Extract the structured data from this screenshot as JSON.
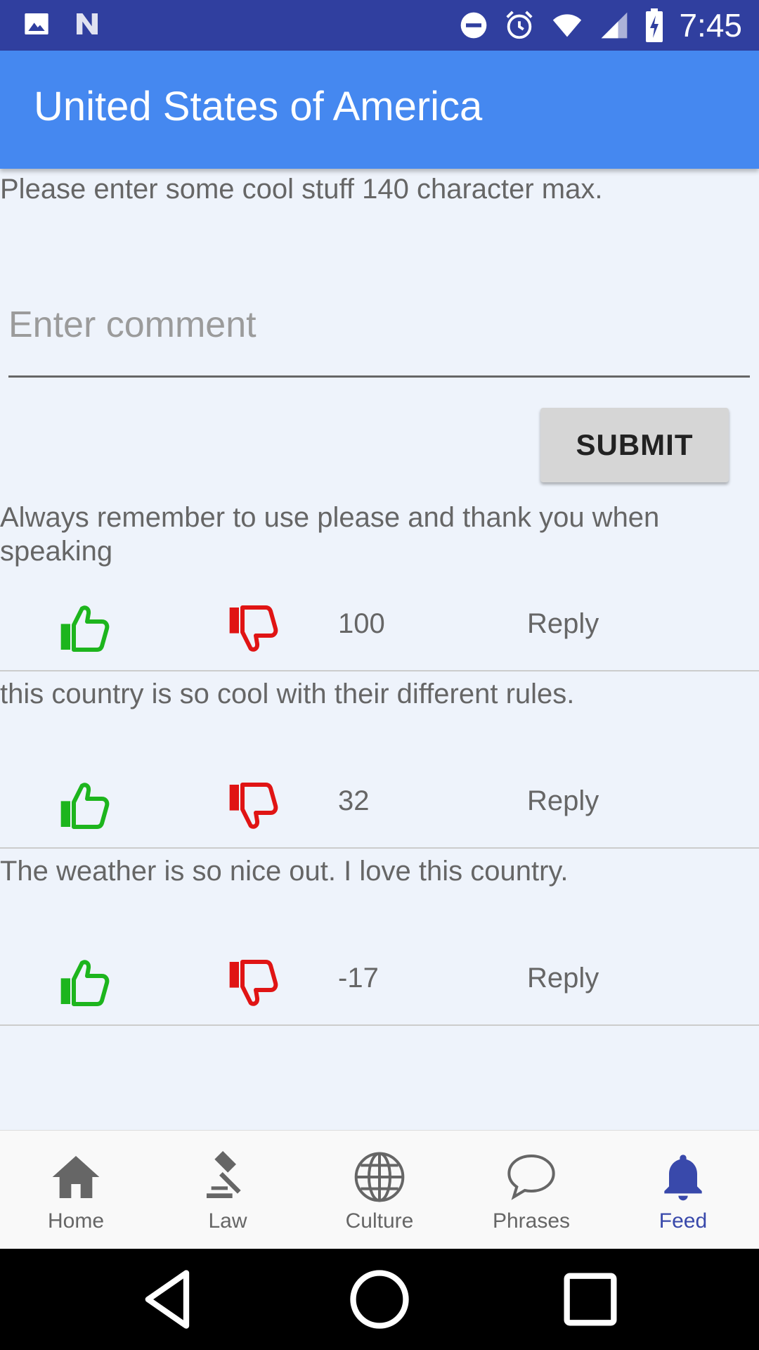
{
  "status_bar": {
    "time": "7:45",
    "left_icons": [
      "image-icon",
      "n-icon"
    ],
    "right_icons": [
      "do-not-disturb-icon",
      "alarm-icon",
      "wifi-icon",
      "signal-icon",
      "battery-charging-icon"
    ]
  },
  "app_bar": {
    "title": "United States of America"
  },
  "composer": {
    "instructions": "Please enter some cool stuff 140 character max.",
    "placeholder": "Enter comment",
    "value": "",
    "submit_label": "SUBMIT"
  },
  "posts": [
    {
      "text": "Always remember to use please and thank you when speaking",
      "score": "100",
      "reply_label": "Reply"
    },
    {
      "text": "this country is so cool with their different rules.",
      "score": "32",
      "reply_label": "Reply"
    },
    {
      "text": "The weather is so nice out. I love this country.",
      "score": "-17",
      "reply_label": "Reply"
    }
  ],
  "bottom_nav": {
    "items": [
      {
        "label": "Home",
        "icon": "home-icon",
        "active": false
      },
      {
        "label": "Law",
        "icon": "gavel-icon",
        "active": false
      },
      {
        "label": "Culture",
        "icon": "globe-icon",
        "active": false
      },
      {
        "label": "Phrases",
        "icon": "chat-bubble-icon",
        "active": false
      },
      {
        "label": "Feed",
        "icon": "bell-icon",
        "active": true
      }
    ]
  },
  "colors": {
    "status_bar": "#303F9F",
    "app_bar": "#4588F0",
    "background": "#EEF3FB",
    "thumb_up": "#1DB51D",
    "thumb_down": "#E01414",
    "active_nav": "#3949AB"
  }
}
